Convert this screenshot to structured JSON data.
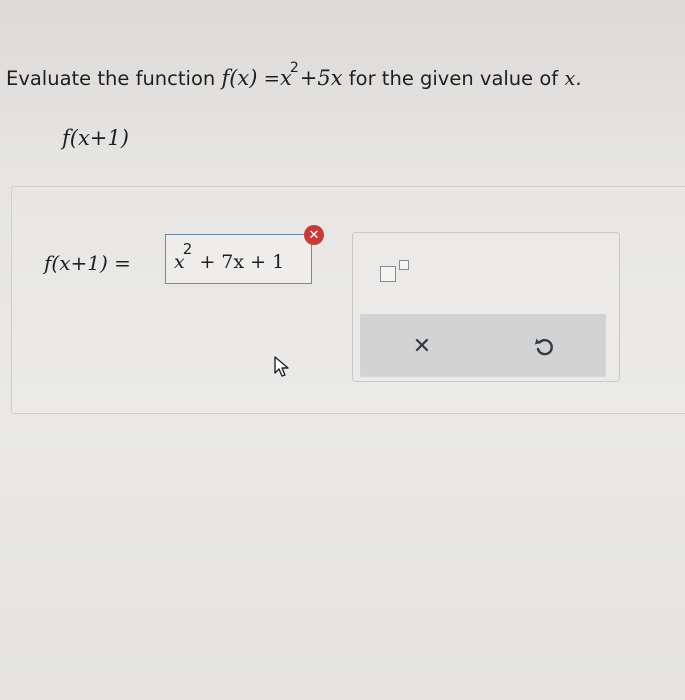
{
  "prompt": {
    "text_before": "Evaluate the function",
    "fx": "f(x)",
    "equals": "=",
    "base": "x",
    "exponent": "2",
    "rest": "+5x",
    "text_after": "for the given value of",
    "var": "x",
    "period": "."
  },
  "problem": {
    "expression": "f(x+1)"
  },
  "answer": {
    "label": "f(x+1) =",
    "base": "x",
    "exponent": "2",
    "rest": "+ 7x + 1",
    "status": "incorrect"
  },
  "tools": {
    "exponent_icon": "exponent-template-icon",
    "clear_icon": "close-icon",
    "clear_glyph": "✕",
    "undo_icon": "undo-icon"
  },
  "colors": {
    "error": "#c63a3a",
    "answer_border": "#6e8aa3",
    "action_bar": "#d2d3d2"
  }
}
